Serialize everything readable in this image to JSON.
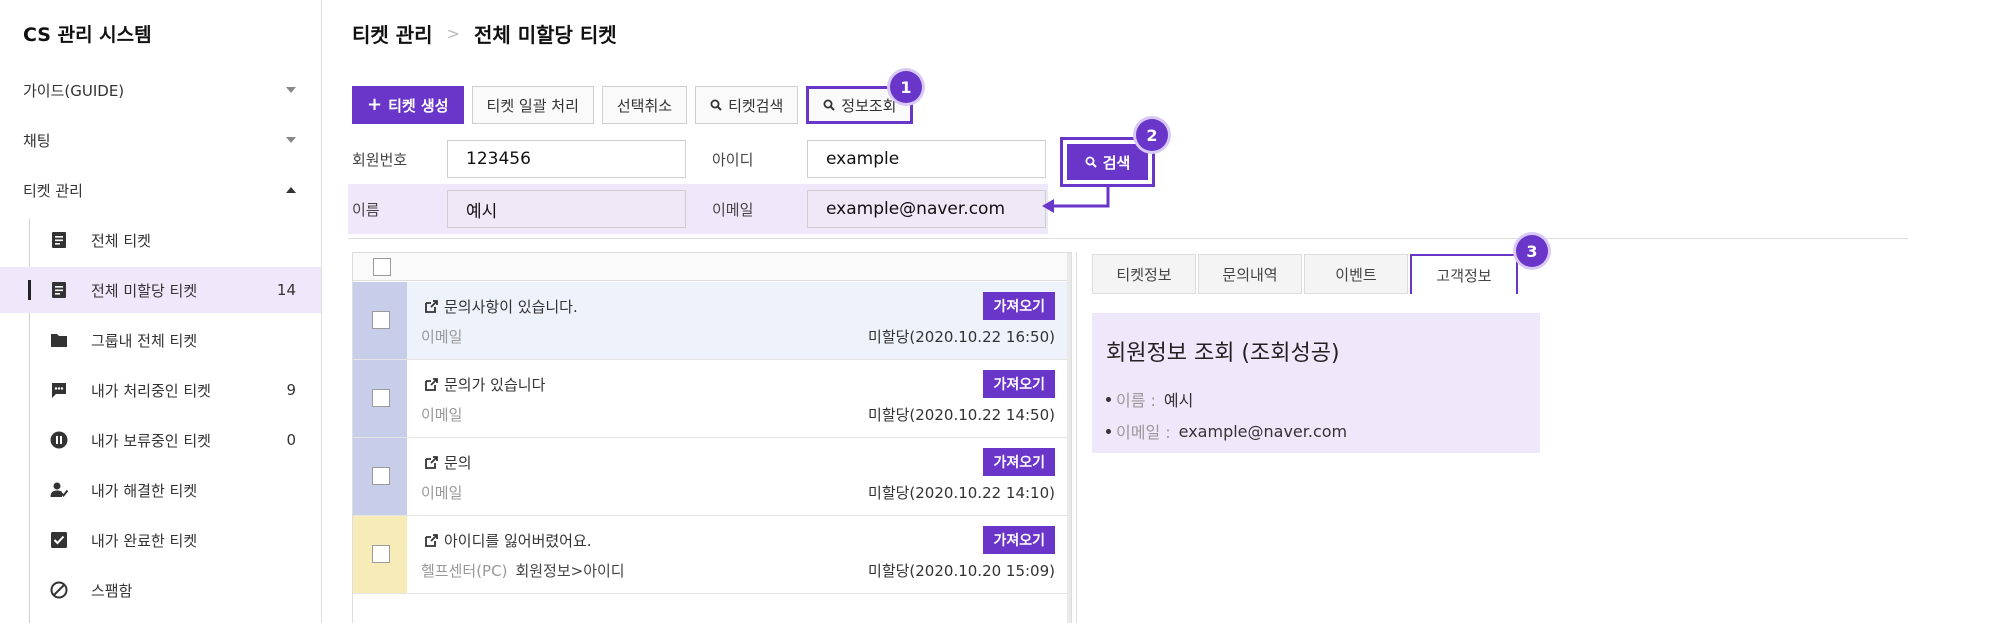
{
  "app": {
    "title": "CS 관리 시스템"
  },
  "sidebar": {
    "menus": [
      {
        "label": "가이드(GUIDE)",
        "expanded": false
      },
      {
        "label": "채팅",
        "expanded": false
      },
      {
        "label": "티켓 관리",
        "expanded": true
      }
    ],
    "items": [
      {
        "label": "전체 티켓",
        "count": "",
        "icon": "document-icon",
        "active": false
      },
      {
        "label": "전체 미할당 티켓",
        "count": "14",
        "icon": "document-icon",
        "active": true
      },
      {
        "label": "그룹내 전체 티켓",
        "count": "",
        "icon": "folder-icon",
        "active": false
      },
      {
        "label": "내가 처리중인 티켓",
        "count": "9",
        "icon": "chat-bubble-icon",
        "active": false
      },
      {
        "label": "내가 보류중인 티켓",
        "count": "0",
        "icon": "pause-icon",
        "active": false
      },
      {
        "label": "내가 해결한 티켓",
        "count": "",
        "icon": "user-check-icon",
        "active": false
      },
      {
        "label": "내가 완료한 티켓",
        "count": "",
        "icon": "checkbox-icon",
        "active": false
      },
      {
        "label": "스팸함",
        "count": "",
        "icon": "block-icon",
        "active": false
      }
    ]
  },
  "breadcrumb": {
    "root": "티켓 관리",
    "current": "전체 미할당 티켓"
  },
  "toolbar": {
    "create": "티켓 생성",
    "bulk": "티켓 일괄 처리",
    "deselect": "선택취소",
    "ticket_search": "티켓검색",
    "info_lookup": "정보조회"
  },
  "callouts": {
    "one": "1",
    "two": "2",
    "three": "3"
  },
  "form": {
    "member_no_label": "회원번호",
    "member_no_value": "123456",
    "id_label": "아이디",
    "id_value": "example",
    "name_label": "이름",
    "name_value": "예시",
    "email_label": "이메일",
    "email_value": "example@naver.com",
    "search_button": "검색"
  },
  "tickets": [
    {
      "title": "문의사항이 있습니다.",
      "channel": "이메일",
      "category": "",
      "status": "미할당(2020.10.22 16:50)",
      "fetch": "가져오기",
      "selected": true,
      "marker": "blue"
    },
    {
      "title": "문의가 있습니다",
      "channel": "이메일",
      "category": "",
      "status": "미할당(2020.10.22 14:50)",
      "fetch": "가져오기",
      "selected": false,
      "marker": "blue"
    },
    {
      "title": "문의",
      "channel": "이메일",
      "category": "",
      "status": "미할당(2020.10.22 14:10)",
      "fetch": "가져오기",
      "selected": false,
      "marker": "blue"
    },
    {
      "title": "아이디를 잃어버렸어요.",
      "channel": "헬프센터(PC)",
      "category": "회원정보>아이디",
      "status": "미할당(2020.10.20 15:09)",
      "fetch": "가져오기",
      "selected": false,
      "marker": "yellow"
    }
  ],
  "detail_tabs": [
    "티켓정보",
    "문의내역",
    "이벤트",
    "고객정보"
  ],
  "customer_info": {
    "title": "회원정보 조회 (조회성공)",
    "name_key": "이름 :",
    "name_value": "예시",
    "email_key": "이메일 :",
    "email_value": "example@naver.com"
  },
  "colors": {
    "accent": "#6a35c9",
    "active_row": "#efe8fb"
  }
}
